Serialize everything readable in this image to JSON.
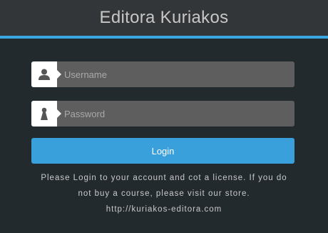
{
  "header": {
    "title": "Editora Kuriakos"
  },
  "form": {
    "username": {
      "icon": "user-icon",
      "placeholder": "Username",
      "value": ""
    },
    "password": {
      "icon": "lock-icon",
      "placeholder": "Password",
      "value": ""
    },
    "login_label": "Login"
  },
  "info": {
    "line1": "Please Login to your account and cot a license. If you do",
    "line2": "not buy a course, please visit our store.",
    "link": "http://kuriakos-editora.com"
  },
  "colors": {
    "background": "#232a2e",
    "header": "#333638",
    "accent": "#3aa7e0",
    "button": "#3aa0dc",
    "field": "#5e5e5e"
  }
}
